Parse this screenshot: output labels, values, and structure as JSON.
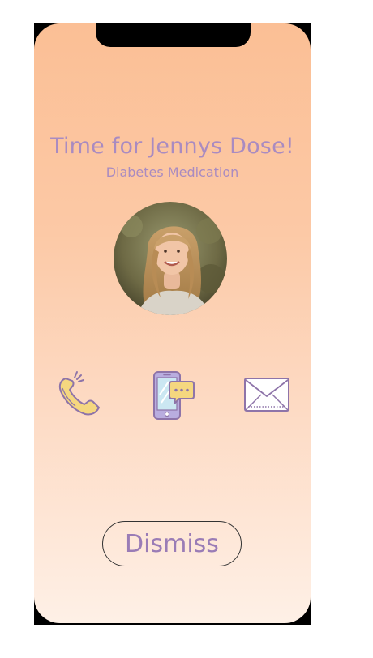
{
  "reminder": {
    "title": "Time for Jennys Dose!",
    "subtitle": "Diabetes Medication"
  },
  "actions": {
    "call_icon": "phone-icon",
    "message_icon": "phone-chat-icon",
    "email_icon": "envelope-icon"
  },
  "dismiss_label": "Dismiss",
  "colors": {
    "accent": "#a98bc1",
    "gradient_top": "#fbbf95",
    "gradient_bottom": "#fef0e6",
    "icon_yellow": "#f5d77f"
  }
}
